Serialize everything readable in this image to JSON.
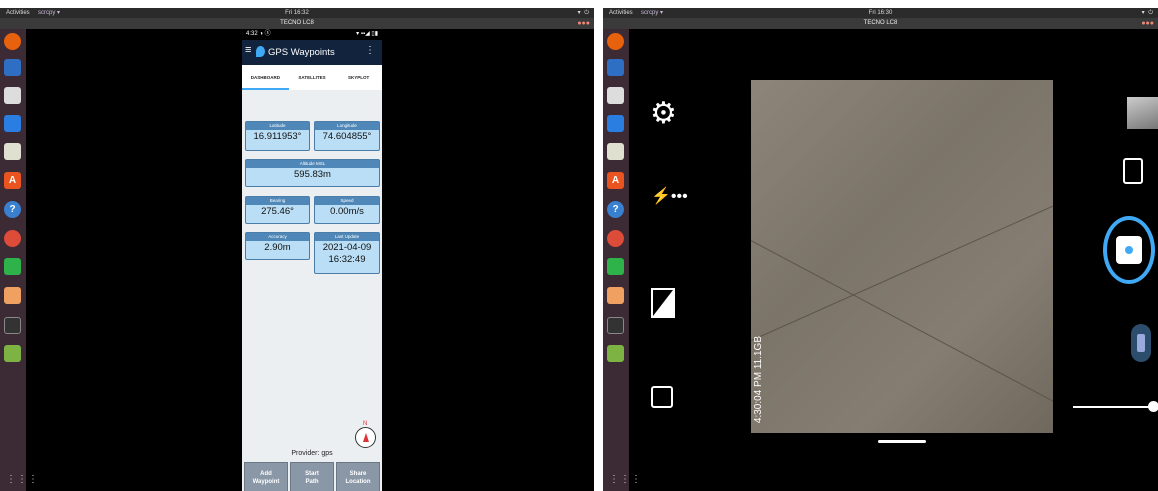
{
  "left_desktop": {
    "topbar": {
      "activities": "Activities",
      "app": "scrcpy ▾",
      "clock": "Fri 16:32",
      "tray": "▾ ⏻"
    },
    "window_title": "TECNO LC8",
    "phone": {
      "status_time": "4:32 ◑ ⓢ",
      "status_right": "▾ ▪▪◢ ▯▮",
      "app_title": "GPS Waypoints",
      "tabs": [
        "DASHBOARD",
        "SATELLITES",
        "SKYPLOT"
      ],
      "cards": {
        "latitude": {
          "label": "Latitude",
          "value": "16.911953°"
        },
        "longitude": {
          "label": "Longitude",
          "value": "74.604855°"
        },
        "altitude": {
          "label": "Altitude MSL",
          "value": "595.83m"
        },
        "bearing": {
          "label": "Bearing",
          "value": "275.46°"
        },
        "speed": {
          "label": "Speed",
          "value": "0.00m/s"
        },
        "accuracy": {
          "label": "Accuracy",
          "value": "2.90m"
        },
        "last_update": {
          "label": "Last Update",
          "date": "2021-04-09",
          "time": "16:32:49"
        }
      },
      "compass_n": "N",
      "provider": "Provider: gps",
      "buttons": {
        "add": [
          "Add",
          "Waypoint"
        ],
        "path": [
          "Start",
          "Path"
        ],
        "share": [
          "Share",
          "Location"
        ]
      }
    }
  },
  "right_desktop": {
    "topbar": {
      "activities": "Activities",
      "app": "scrcpy ▾",
      "clock": "Fri 16:30",
      "tray": "▾ ⏻"
    },
    "window_title": "TECNO LC8",
    "camera": {
      "overlay_time": "4:30:04 PM",
      "overlay_storage": "11.1GB"
    }
  },
  "colors": {
    "accent": "#3fa9f5",
    "appbar": "#12233d",
    "card": "#b9def5"
  }
}
